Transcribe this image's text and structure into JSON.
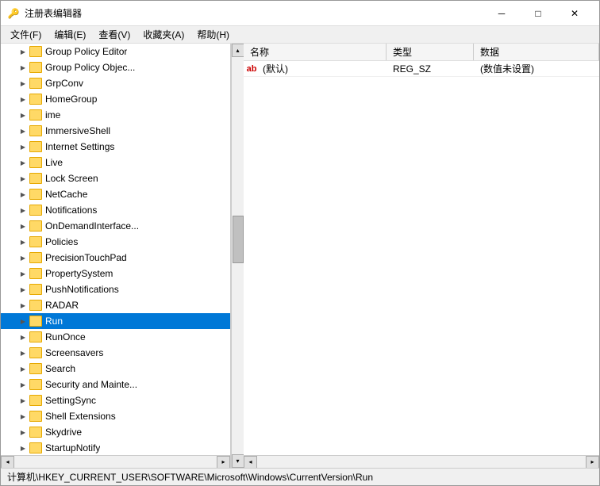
{
  "window": {
    "title": "注册表编辑器",
    "icon": "🔑"
  },
  "titlebar": {
    "minimize": "─",
    "maximize": "□",
    "close": "✕"
  },
  "menubar": {
    "items": [
      {
        "label": "文件(F)"
      },
      {
        "label": "编辑(E)"
      },
      {
        "label": "查看(V)"
      },
      {
        "label": "收藏夹(A)"
      },
      {
        "label": "帮助(H)"
      }
    ]
  },
  "tree": {
    "items": [
      {
        "label": "Group Policy Editor",
        "indent": 1,
        "expanded": false
      },
      {
        "label": "Group Policy Objec...",
        "indent": 1,
        "expanded": false
      },
      {
        "label": "GrpConv",
        "indent": 1,
        "expanded": false
      },
      {
        "label": "HomeGroup",
        "indent": 1,
        "expanded": false
      },
      {
        "label": "ime",
        "indent": 1,
        "expanded": false
      },
      {
        "label": "ImmersiveShell",
        "indent": 1,
        "expanded": false
      },
      {
        "label": "Internet Settings",
        "indent": 1,
        "expanded": false
      },
      {
        "label": "Live",
        "indent": 1,
        "expanded": false
      },
      {
        "label": "Lock Screen",
        "indent": 1,
        "expanded": false
      },
      {
        "label": "NetCache",
        "indent": 1,
        "expanded": false
      },
      {
        "label": "Notifications",
        "indent": 1,
        "expanded": false
      },
      {
        "label": "OnDemandInterface...",
        "indent": 1,
        "expanded": false
      },
      {
        "label": "Policies",
        "indent": 1,
        "expanded": false
      },
      {
        "label": "PrecisionTouchPad",
        "indent": 1,
        "expanded": false
      },
      {
        "label": "PropertySystem",
        "indent": 1,
        "expanded": false
      },
      {
        "label": "PushNotifications",
        "indent": 1,
        "expanded": false
      },
      {
        "label": "RADAR",
        "indent": 1,
        "expanded": false
      },
      {
        "label": "Run",
        "indent": 1,
        "expanded": false,
        "selected": true
      },
      {
        "label": "RunOnce",
        "indent": 1,
        "expanded": false
      },
      {
        "label": "Screensavers",
        "indent": 1,
        "expanded": false
      },
      {
        "label": "Search",
        "indent": 1,
        "expanded": false
      },
      {
        "label": "Security and Mainte...",
        "indent": 1,
        "expanded": false
      },
      {
        "label": "SettingSync",
        "indent": 1,
        "expanded": false
      },
      {
        "label": "Shell Extensions",
        "indent": 1,
        "expanded": false
      },
      {
        "label": "Skydrive",
        "indent": 1,
        "expanded": false
      },
      {
        "label": "StartupNotify",
        "indent": 1,
        "expanded": false
      }
    ]
  },
  "columns": {
    "name": "名称",
    "type": "类型",
    "data": "数据"
  },
  "registry": {
    "rows": [
      {
        "icon": "ab",
        "name": "(默认)",
        "type": "REG_SZ",
        "data": "(数值未设置)"
      }
    ]
  },
  "statusbar": {
    "path": "计算机\\HKEY_CURRENT_USER\\SOFTWARE\\Microsoft\\Windows\\CurrentVersion\\Run"
  }
}
